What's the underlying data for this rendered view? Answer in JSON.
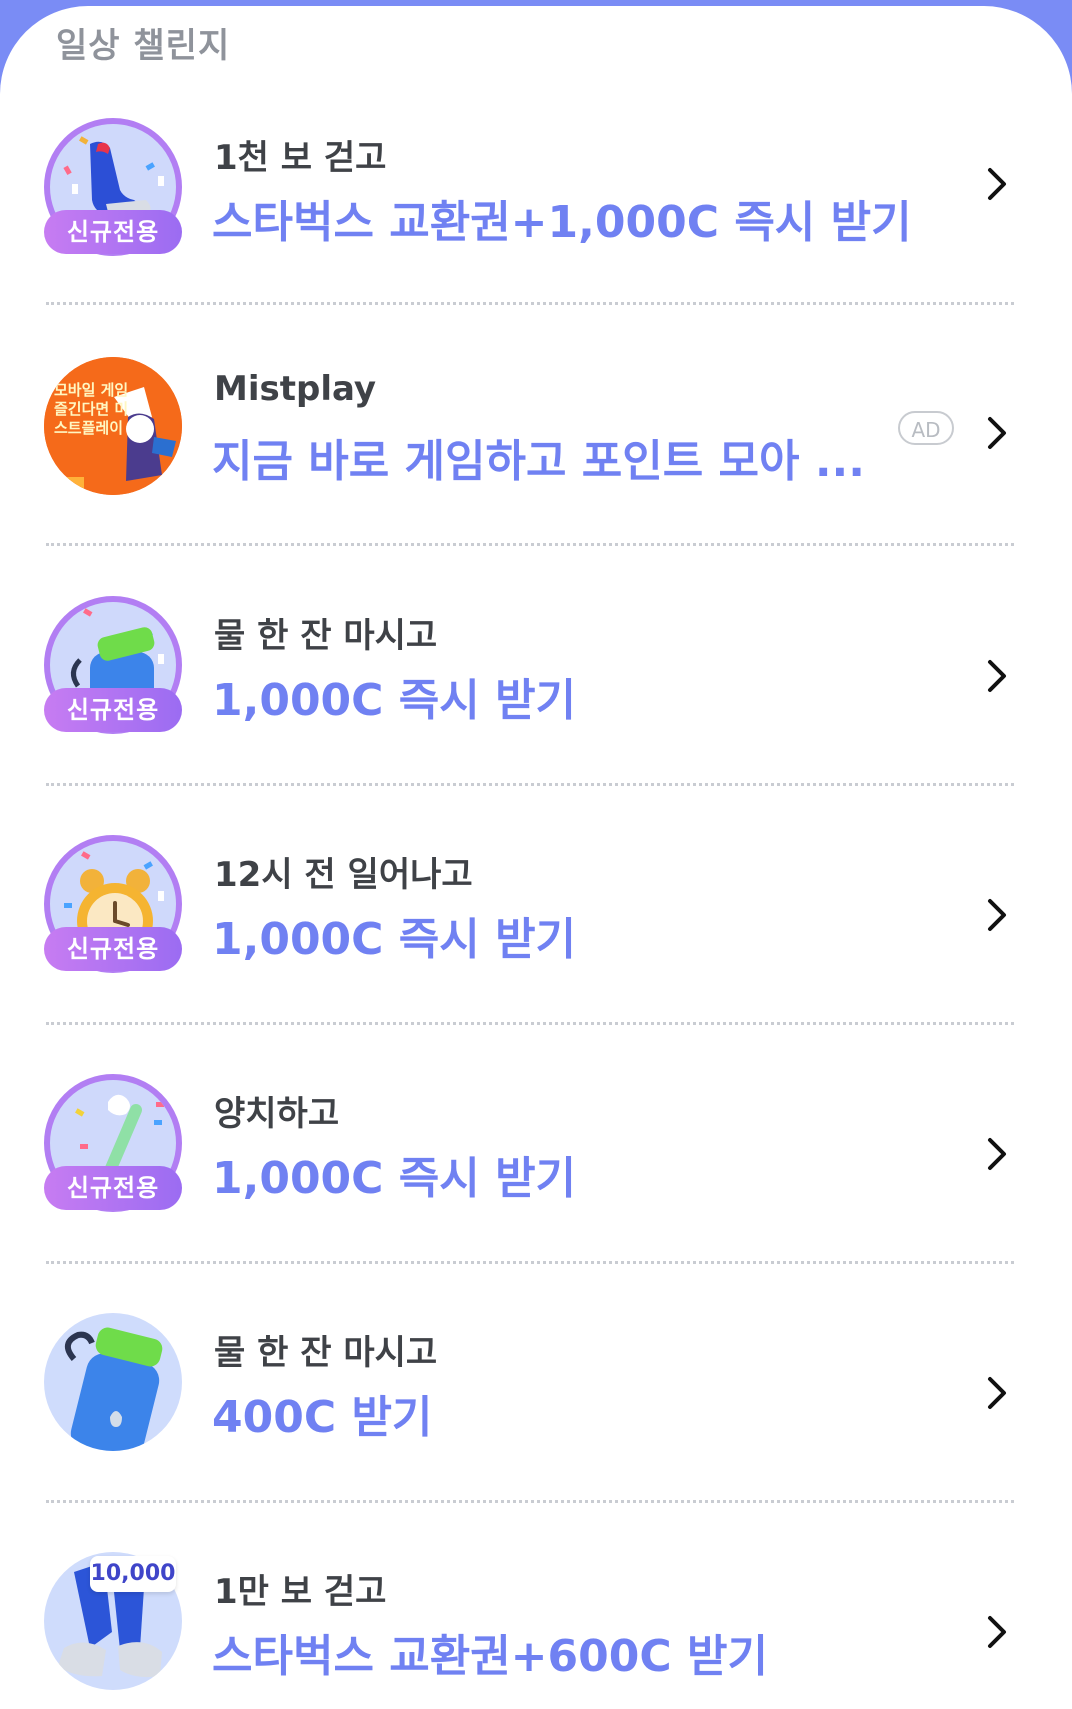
{
  "section": {
    "title": "일상 챌린지"
  },
  "badge_label": "신규전용",
  "items": [
    {
      "title": "1천 보 걷고",
      "subtitle": "스타벅스 교환권+1,000C 즉시 받기",
      "icon": "sneaker-icon",
      "new_only": true
    },
    {
      "title": "Mistplay",
      "subtitle": "지금 바로 게임하고 포인트 모아 ...",
      "icon": "mistplay-ad-thumbnail",
      "ad_label": "AD",
      "thumb_text": "모바일 게임 즐긴다면 미스트플레이"
    },
    {
      "title": "물 한 잔 마시고",
      "subtitle": "1,000C 즉시 받기",
      "icon": "water-bottle-icon",
      "new_only": true
    },
    {
      "title": "12시 전 일어나고",
      "subtitle": "1,000C 즉시 받기",
      "icon": "alarm-clock-icon",
      "new_only": true
    },
    {
      "title": "양치하고",
      "subtitle": "1,000C 즉시 받기",
      "icon": "toothbrush-icon",
      "new_only": true
    },
    {
      "title": "물 한 잔 마시고",
      "subtitle": "400C 받기",
      "icon": "water-bottle-icon",
      "new_only": false
    },
    {
      "title": "1만 보 걷고",
      "subtitle": "스타벅스 교환권+600C 받기",
      "icon": "running-legs-icon",
      "new_only": false,
      "thumb_tag": "10,000"
    }
  ],
  "colors": {
    "accent": "#7081f2",
    "header_bg": "#7a8cf5",
    "badge_gradient": [
      "#c77cf2",
      "#9b6cf2"
    ],
    "title_text": "#3f4247",
    "section_text": "#8f939b"
  }
}
